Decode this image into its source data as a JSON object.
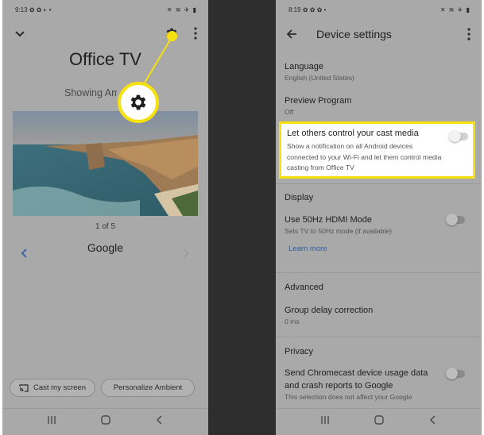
{
  "left_screen": {
    "status": {
      "time": "9:13",
      "left_icons": "✿ ✿ ◐ •",
      "right_icons": "✕ ≋ ✈ ▮"
    },
    "title": "Office TV",
    "subtitle": "Showing Ambient",
    "counter": "1 of 5",
    "source": "Google",
    "chips": {
      "cast": "Cast my screen",
      "personalize": "Personalize Ambient"
    }
  },
  "right_screen": {
    "status": {
      "time": "8:19",
      "left_icons": "✿ ✿ ✿ •",
      "right_icons": "✕ ≋ ✈ ▮"
    },
    "title": "Device settings",
    "language": {
      "title": "Language",
      "value": "English (United States)"
    },
    "preview": {
      "title": "Preview Program",
      "value": "Off"
    },
    "cast_control": {
      "title": "Let others control your cast media",
      "desc": "Show a notification on all Android devices connected to your Wi-Fi and let them control media casting from Office TV",
      "enabled": false
    },
    "display": {
      "header": "Display",
      "hdmi": {
        "title": "Use 50Hz HDMI Mode",
        "desc": "Sets TV to 50Hz mode (if available)",
        "enabled": false
      },
      "learn_more": "Learn more"
    },
    "advanced": {
      "header": "Advanced",
      "delay": {
        "title": "Group delay correction",
        "value": "0 ms"
      }
    },
    "privacy": {
      "header": "Privacy",
      "usage": {
        "title_line1": "Send Chromecast device usage data",
        "title_line2": "and crash reports to Google",
        "desc": "This selection does not affect your Google",
        "enabled": false
      }
    }
  },
  "colors": {
    "highlight": "#f6e10f",
    "dim_overlay": "#a9a9a9",
    "link": "#2f5f9e"
  }
}
